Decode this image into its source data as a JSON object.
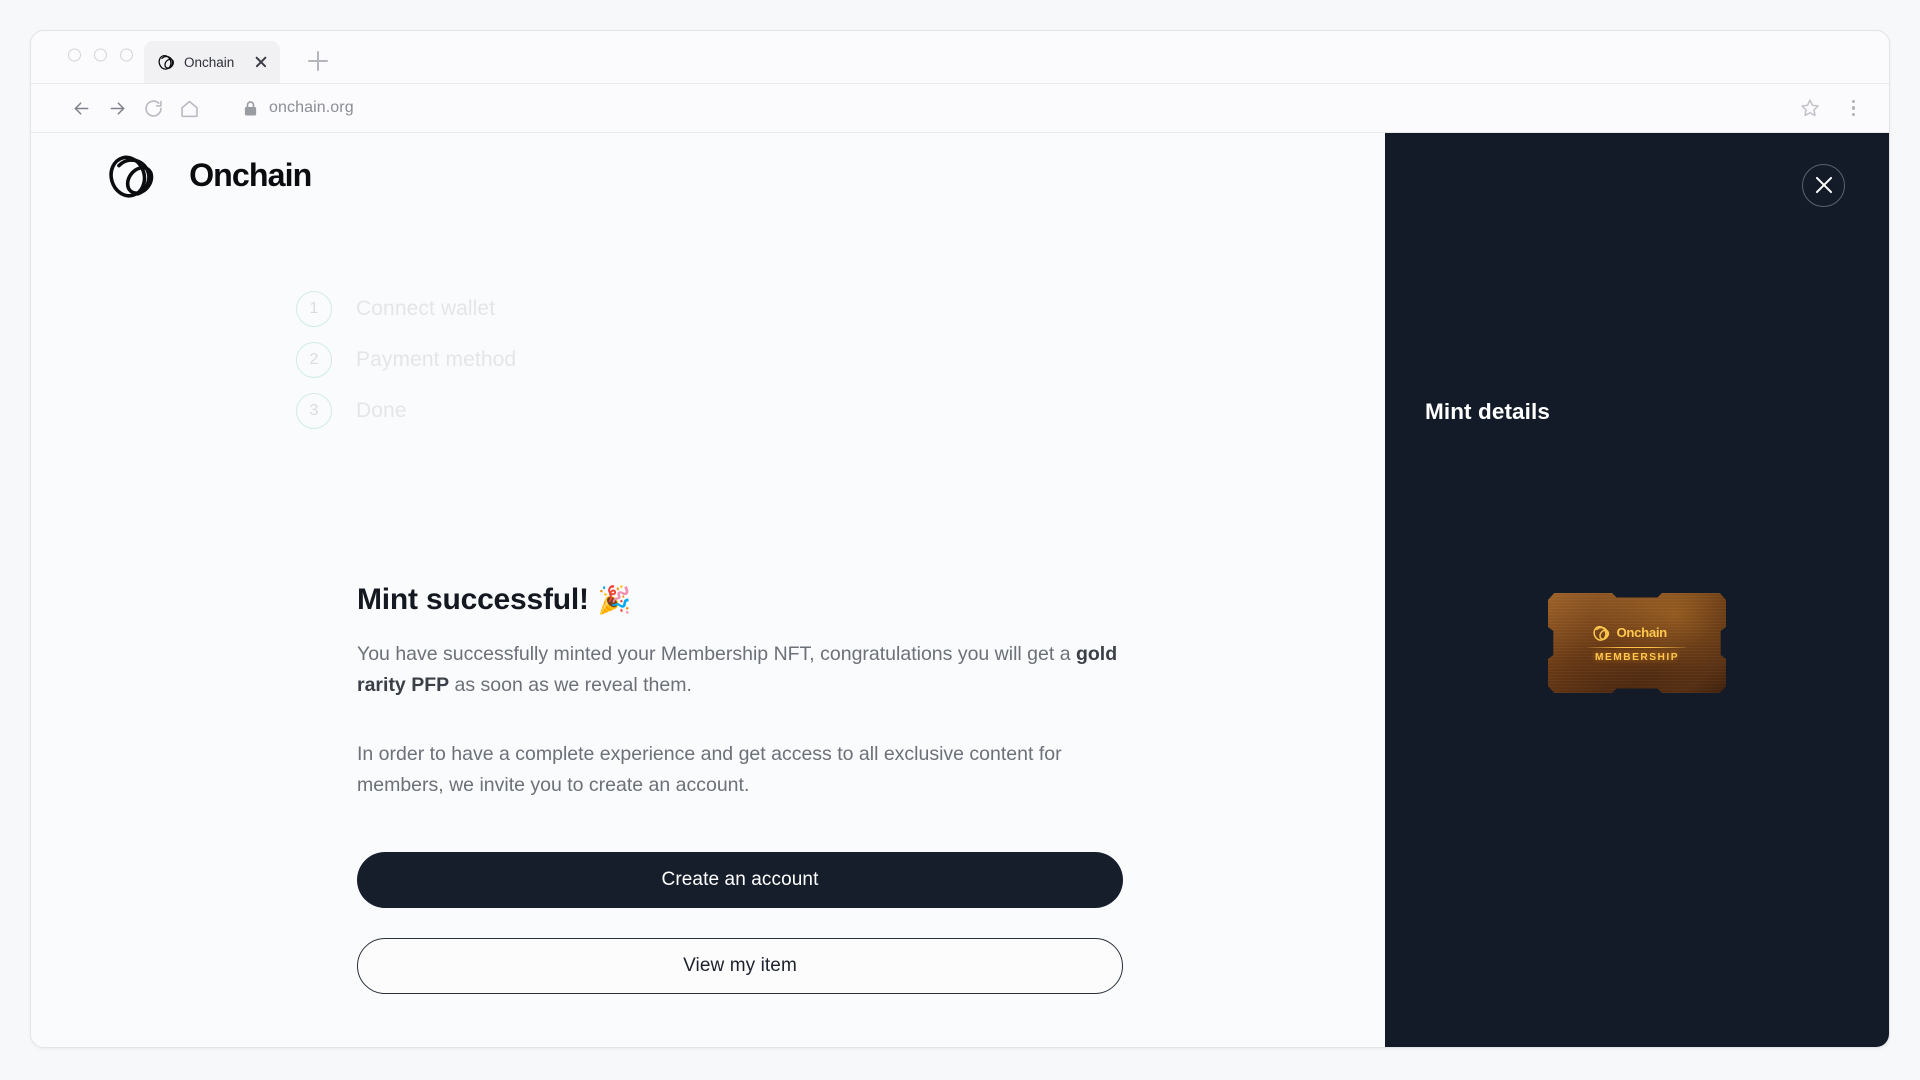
{
  "browser": {
    "traffic_lights": [
      "close",
      "minimize",
      "maximize"
    ],
    "tab": {
      "title": "Onchain",
      "favicon": "onchain-logo-icon",
      "close": "close-icon"
    },
    "new_tab": "+",
    "nav": {
      "back": "back-arrow-icon",
      "forward": "forward-arrow-icon",
      "reload": "reload-icon",
      "home": "home-icon"
    },
    "address": {
      "lock": "lock-icon",
      "url": "onchain.org"
    },
    "actions": {
      "bookmark": "star-icon",
      "menu": "kebab-menu-icon"
    }
  },
  "site": {
    "logo_text": "Onchain"
  },
  "stepper": {
    "steps": [
      {
        "number": "1",
        "label": "Connect wallet"
      },
      {
        "number": "2",
        "label": "Payment method"
      },
      {
        "number": "3",
        "label": "Done"
      }
    ]
  },
  "main": {
    "headline": "Mint successful!",
    "headline_emoji": "🎉",
    "paragraph_1_part_1": "You have successfully minted your Membership NFT, congratulations you will get a ",
    "paragraph_1_bold": "gold rarity PFP",
    "paragraph_1_part_2": " as soon as we reveal them.",
    "paragraph_2": "In order to have a complete experience and get access to all exclusive content for members, we invite you to create an account.",
    "primary_button": "Create an account",
    "secondary_button": "View my item"
  },
  "side_panel": {
    "title": "Mint details",
    "close": "close-icon",
    "nft": {
      "brand": "Onchain",
      "tier": "MEMBERSHIP"
    }
  },
  "colors": {
    "page_bg": "#fafbfc",
    "panel_bg": "#141b28",
    "primary_button_bg": "#161d2b",
    "step_circle_border": "#a9ddcb",
    "muted_text": "#6c7078",
    "nft_gold": "#ffc74d"
  }
}
